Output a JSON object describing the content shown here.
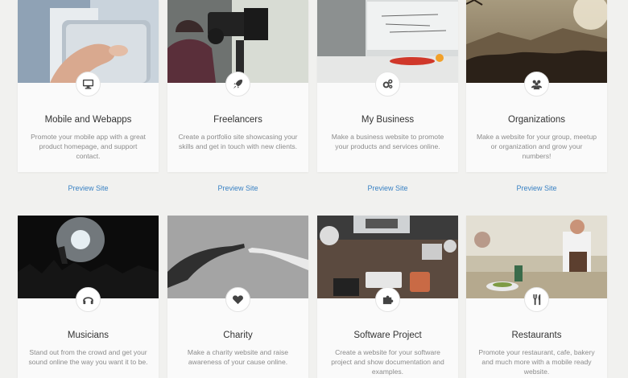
{
  "cards": [
    {
      "title": "Mobile and Webapps",
      "desc": "Promote your mobile app with a great product homepage, and support contact.",
      "icon": "desktop-icon",
      "image": "hand-holding-phone"
    },
    {
      "title": "Freelancers",
      "desc": "Create a portfolio site showcasing your skills and get in touch with new clients.",
      "icon": "rocket-icon",
      "image": "video-camera"
    },
    {
      "title": "My Business",
      "desc": "Make a business website to promote your products and services online.",
      "icon": "gears-icon",
      "image": "office-whiteboard"
    },
    {
      "title": "Organizations",
      "desc": "Make a website for your group, meetup or organization and grow your numbers!",
      "icon": "users-icon",
      "image": "crowd-sunset"
    },
    {
      "title": "Musicians",
      "desc": "Stand out from the crowd and get your sound online the way you want it to be.",
      "icon": "headphones-icon",
      "image": "concert-crowd"
    },
    {
      "title": "Charity",
      "desc": "Make a charity website and raise awareness of your cause online.",
      "icon": "heart-icon",
      "image": "reaching-hands"
    },
    {
      "title": "Software Project",
      "desc": "Create a website for your software project and show documentation and examples.",
      "icon": "puzzle-icon",
      "image": "desk-from-above"
    },
    {
      "title": "Restaurants",
      "desc": "Promote your restaurant, cafe, bakery and much more with a mobile ready website.",
      "icon": "cutlery-icon",
      "image": "chef-kitchen"
    }
  ],
  "preview_label": "Preview Site",
  "colors": {
    "link": "#3a82c4",
    "title": "#333333",
    "desc": "#8b8b8b",
    "background": "#f1f1ef"
  }
}
